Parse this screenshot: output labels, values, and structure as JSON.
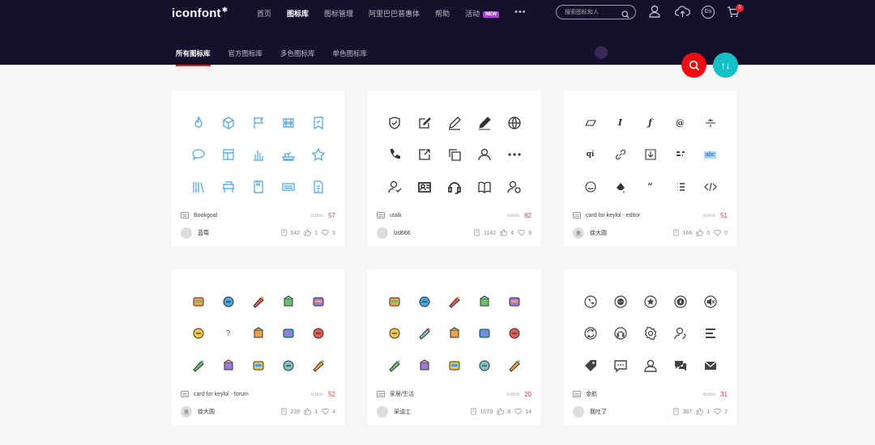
{
  "logo": "iconfont",
  "nav": [
    {
      "label": "首页"
    },
    {
      "label": "图标库"
    },
    {
      "label": "图标管理"
    },
    {
      "label": "阿里巴巴普惠体"
    },
    {
      "label": "帮助"
    },
    {
      "label": "活动",
      "badge": "NEW"
    }
  ],
  "more": "•••",
  "search": {
    "placeholder": "搜索图标和人"
  },
  "lang": "En",
  "cart_count": "0",
  "subnav": [
    "所有图标库",
    "官方图标库",
    "多色图标库",
    "单色图标库"
  ],
  "sort_label": "↑↓",
  "colors": {
    "header": "#13112c",
    "accent_red": "#e5232a",
    "teal": "#16c0c7",
    "blue_icon": "#4aa3df"
  },
  "cards": [
    {
      "name": "Bookgoal",
      "icons_label": "icons",
      "icons_count": "57",
      "user": "蓝莓",
      "avatar": "",
      "views": "542",
      "likes": "1",
      "favs": "5",
      "style": "blue-line",
      "icons": [
        "fire-icon",
        "cube-icon",
        "flag-icon",
        "layers-icon",
        "bookmark-icon",
        "chat-icon",
        "table-icon",
        "bar-chart-icon",
        "boat-icon",
        "star-icon",
        "books-icon",
        "sofa-icon",
        "notebook-icon",
        "keyboard-icon",
        "document-icon"
      ]
    },
    {
      "name": "utalk",
      "icons_label": "icons",
      "icons_count": "62",
      "user": "lzd666",
      "avatar": "",
      "views": "1142",
      "likes": "4",
      "favs": "9",
      "style": "dark-line",
      "icons": [
        "shield-check-icon",
        "edit-square-icon",
        "pencil-icon",
        "pen-filled-icon",
        "globe-icon",
        "phone-icon",
        "share-square-icon",
        "copy-icon",
        "user-icon",
        "more-icon",
        "user-check-icon",
        "contact-card-icon",
        "headset-icon",
        "book-open-icon",
        "user-settings-icon"
      ]
    },
    {
      "name": "card for keylol - editor",
      "icons_label": "icons",
      "icons_count": "51",
      "user": "徐大圆",
      "avatar": "黑",
      "views": "166",
      "likes": "0",
      "favs": "0",
      "style": "editor",
      "icons": [
        "eraser-icon",
        "italic-icon",
        "function-icon",
        "at-icon",
        "strikethrough-icon",
        "qi-text-icon",
        "link-icon",
        "download-icon",
        "list-ordered-icon",
        "highlight-abc-icon",
        "emoji-icon",
        "paint-drop-icon",
        "quote-icon",
        "list-icon",
        "code-icon"
      ]
    },
    {
      "name": "card for keylol - forum",
      "icons_label": "icons",
      "icons_count": "52",
      "user": "徐大圆",
      "avatar": "黑",
      "views": "239",
      "likes": "1",
      "favs": "4",
      "style": "color",
      "icons": [
        "card-icon",
        "person-icon",
        "tools-icon",
        "cross-icon",
        "pencil-color-icon",
        "hands-icon",
        "question-icon",
        "printer-icon",
        "folder-icon",
        "photo-icon",
        "astronaut-icon",
        "tree-icon",
        "emoji-color-icon",
        "chart-block-icon",
        "megaphone-icon"
      ]
    },
    {
      "name": "家居/生活",
      "icons_label": "icons",
      "icons_count": "20",
      "user": "采油工",
      "avatar": "",
      "views": "1078",
      "likes": "8",
      "favs": "14",
      "style": "color",
      "icons": [
        "sofa-color-icon",
        "bathtub-icon",
        "chair-icon",
        "pet-icon",
        "roller-icon",
        "frame-icon",
        "cloche-icon",
        "tv-icon",
        "jar-icon",
        "bulb-icon",
        "cup-icon",
        "bike-icon",
        "shirt-icon",
        "bin-icon",
        "fan-icon"
      ]
    },
    {
      "name": "金航",
      "icons_label": "icons",
      "icons_count": "31",
      "user": "我吐了",
      "avatar": "",
      "views": "387",
      "likes": "1",
      "favs": "2",
      "style": "gray-line",
      "icons": [
        "phone-circle-icon",
        "message-circle-icon",
        "star-circle-icon",
        "info-circle-icon",
        "mute-circle-icon",
        "sync-circle-icon",
        "headphones-icon",
        "gear-icon",
        "user-pin-icon",
        "menu-lines-icon",
        "tag-icon",
        "chat-bubble-icon",
        "users-icon",
        "comments-icon",
        "mail-icon"
      ]
    }
  ]
}
